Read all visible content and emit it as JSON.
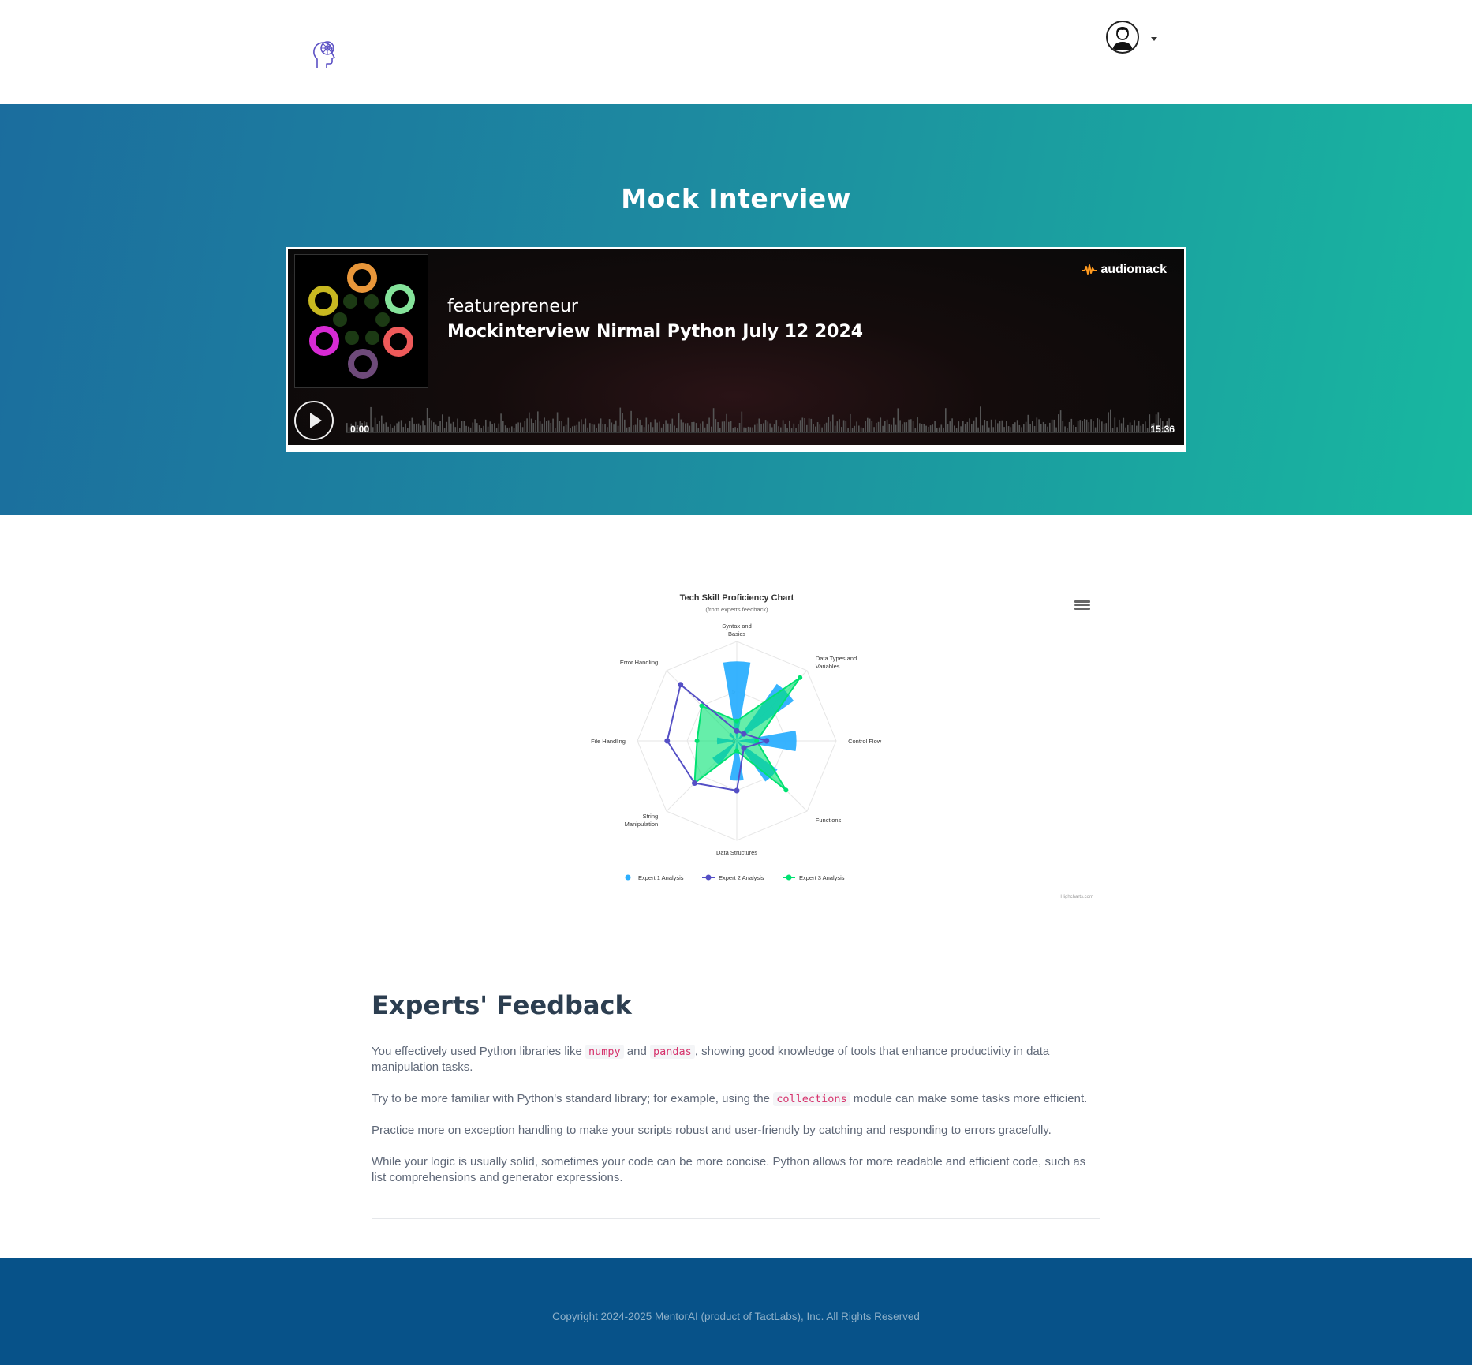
{
  "nav": {
    "logo_icon": "brain-head-icon",
    "avatar_icon": "user-avatar-icon"
  },
  "hero": {
    "title": "Mock Interview"
  },
  "player": {
    "brand": "audiomack",
    "artist": "featurepreneur",
    "track_title": "Mockinterview Nirmal Python July 12 2024",
    "time_current": "0:00",
    "time_total": "15:36",
    "progress": 0
  },
  "chart": {
    "menu_icon": "hamburger-menu-icon",
    "credit": "Highcharts.com"
  },
  "chart_data": {
    "type": "radar",
    "title": "Tech Skill Proficiency Chart",
    "subtitle": "(from experts feedback)",
    "categories": [
      "Syntax and Basics",
      "Data Types and Variables",
      "Control Flow",
      "Functions",
      "Data Structures",
      "String Manipulation",
      "File Handling",
      "Error Handling"
    ],
    "ylim": [
      0,
      10
    ],
    "series": [
      {
        "name": "Expert 1 Analysis",
        "kind": "column",
        "color": "#2caffe",
        "values": [
          8,
          7,
          6,
          5,
          4,
          3,
          2,
          1
        ]
      },
      {
        "name": "Expert 2 Analysis",
        "kind": "line",
        "color": "#544fc5",
        "values": [
          1,
          1,
          3,
          1,
          5,
          6,
          7,
          8
        ]
      },
      {
        "name": "Expert 3 Analysis",
        "kind": "area",
        "color": "#00e272",
        "values": [
          2,
          9,
          2,
          7,
          1,
          6,
          4,
          5
        ]
      }
    ],
    "legend": "bottom",
    "grid": true
  },
  "feedback": {
    "title": "Experts' Feedback",
    "p1": {
      "a": "You effectively used Python libraries like ",
      "code1": "numpy",
      "b": " and ",
      "code2": "pandas",
      "c": ", showing good knowledge of tools that enhance productivity in data manipulation tasks."
    },
    "p2": {
      "a": "Try to be more familiar with Python's standard library; for example, using the ",
      "code1": "collections",
      "b": " module can make some tasks more efficient."
    },
    "p3": "Practice more on exception handling to make your scripts robust and user-friendly by catching and responding to errors gracefully.",
    "p4": "While your logic is usually solid, sometimes your code can be more concise. Python allows for more readable and efficient code, such as list comprehensions and generator expressions."
  },
  "footer": {
    "copyright": "Copyright 2024-2025 MentorAI (product of TactLabs), Inc. All Rights Reserved"
  }
}
